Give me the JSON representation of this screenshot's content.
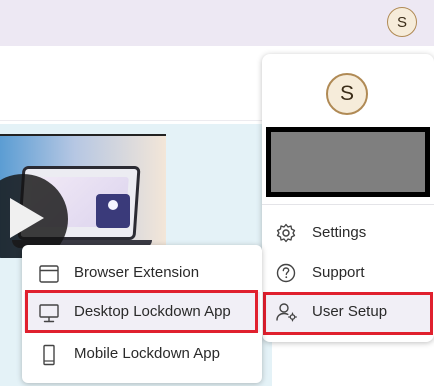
{
  "topbar": {
    "avatar_initial": "S"
  },
  "account_menu": {
    "avatar_initial": "S",
    "items": [
      {
        "label": "Settings",
        "icon": "gear-icon"
      },
      {
        "label": "Support",
        "icon": "question-circle-icon"
      },
      {
        "label": "User Setup",
        "icon": "user-settings-icon"
      }
    ]
  },
  "install_menu": {
    "items": [
      {
        "label": "Browser Extension",
        "icon": "browser-window-icon"
      },
      {
        "label": "Desktop Lockdown App",
        "icon": "desktop-monitor-icon"
      },
      {
        "label": "Mobile Lockdown App",
        "icon": "mobile-phone-icon"
      }
    ]
  },
  "colors": {
    "highlight": "#e0202e",
    "avatar_border": "#b08a55"
  }
}
